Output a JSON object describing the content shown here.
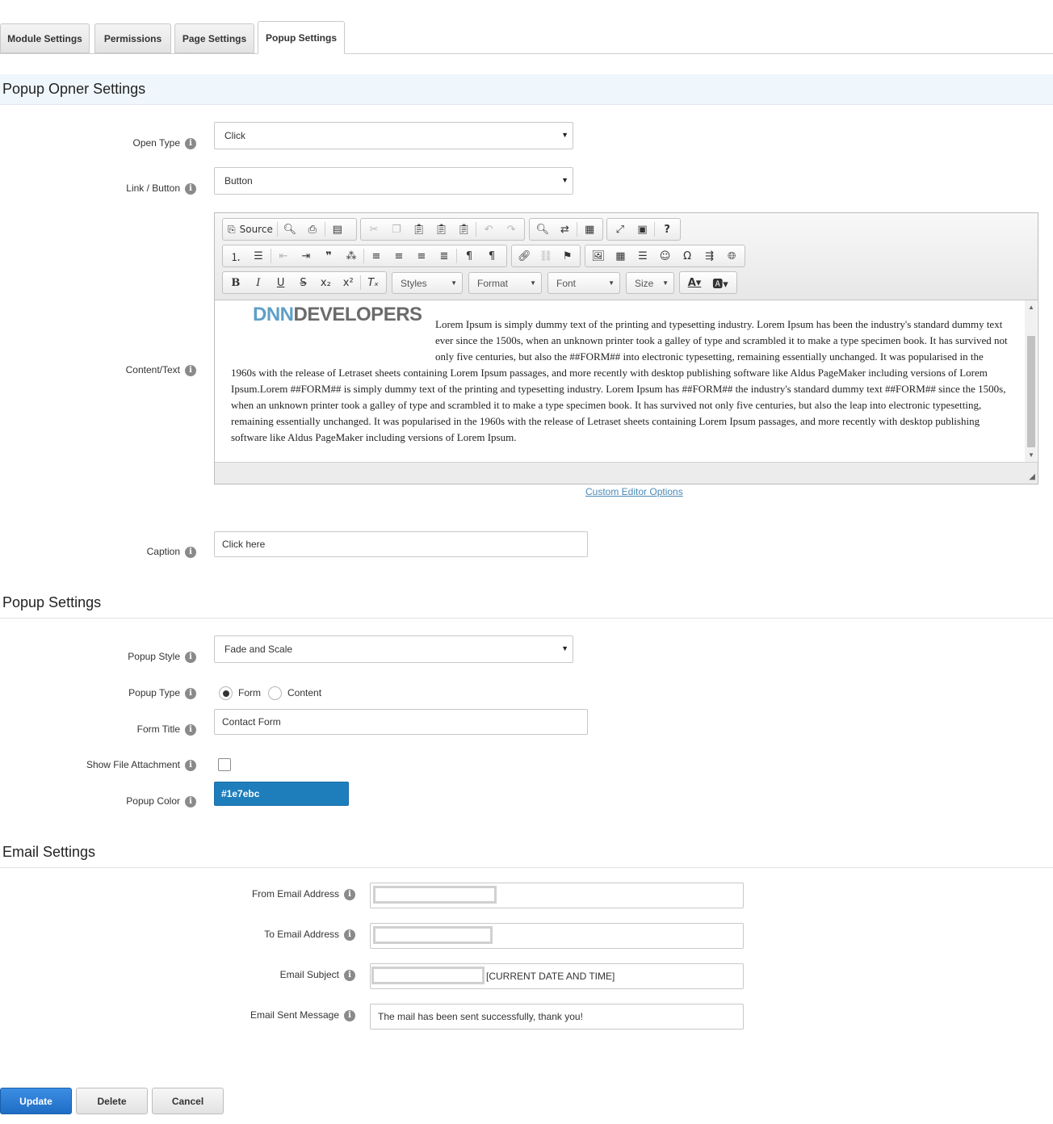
{
  "tabs": [
    {
      "label": "Module Settings"
    },
    {
      "label": "Permissions"
    },
    {
      "label": "Page Settings"
    },
    {
      "label": "Popup Settings"
    }
  ],
  "opener": {
    "title": "Popup Opner Settings",
    "open_type": {
      "label": "Open Type",
      "value": "Click"
    },
    "link_button": {
      "label": "Link / Button",
      "value": "Button"
    },
    "content": {
      "label": "Content/Text"
    },
    "caption": {
      "label": "Caption",
      "value": "Click here"
    }
  },
  "editor": {
    "source_label": "Source",
    "styles_label": "Styles",
    "format_label": "Format",
    "font_label": "Font",
    "size_label": "Size",
    "logo_part1": "DNN",
    "logo_part2": "DEVELOPERS",
    "body": "Lorem Ipsum is simply dummy text of the printing and typesetting industry. Lorem Ipsum has been the industry's standard dummy text ever since the 1500s, when an unknown printer took a galley of type and scrambled it to make a type specimen book. It has survived not only five centuries, but also the ##FORM## into electronic typesetting, remaining essentially unchanged. It was popularised in the 1960s with the release of Letraset sheets containing Lorem Ipsum passages, and more recently with desktop publishing software like Aldus PageMaker including versions of Lorem Ipsum.Lorem ##FORM## is simply dummy text of the printing and typesetting industry. Lorem Ipsum has ##FORM## the industry's standard dummy text ##FORM## since the 1500s, when an unknown printer took a galley of type and scrambled it to make a type specimen book. It has survived not only five centuries, but also the leap into electronic typesetting, remaining essentially unchanged. It was popularised in the 1960s with the release of Letraset sheets containing Lorem Ipsum passages, and more recently with desktop publishing software like Aldus PageMaker including versions of Lorem Ipsum.",
    "custom_options_link": "Custom Editor Options"
  },
  "popup": {
    "title": "Popup Settings",
    "style": {
      "label": "Popup Style",
      "value": "Fade and Scale"
    },
    "type": {
      "label": "Popup Type",
      "option_form": "Form",
      "option_content": "Content",
      "selected": "Form"
    },
    "form_title": {
      "label": "Form Title",
      "value": "Contact Form"
    },
    "show_attachment": {
      "label": "Show File Attachment",
      "checked": false
    },
    "color": {
      "label": "Popup Color",
      "value": "#1e7ebc"
    }
  },
  "email": {
    "title": "Email Settings",
    "from": {
      "label": "From Email Address"
    },
    "to": {
      "label": "To Email Address"
    },
    "subject": {
      "label": "Email Subject",
      "suffix": "[CURRENT DATE AND TIME]"
    },
    "sent_message": {
      "label": "Email Sent Message",
      "value": "The mail has been sent successfully, thank you!"
    }
  },
  "actions": {
    "update": "Update",
    "delete": "Delete",
    "cancel": "Cancel"
  },
  "colors": {
    "primary_button": "#2a7ad6",
    "popup_color": "#1e7ebc",
    "section_band": "#f0f7fc"
  },
  "icons": {
    "info": "info-icon",
    "dropdown": "chevron-down-icon"
  }
}
